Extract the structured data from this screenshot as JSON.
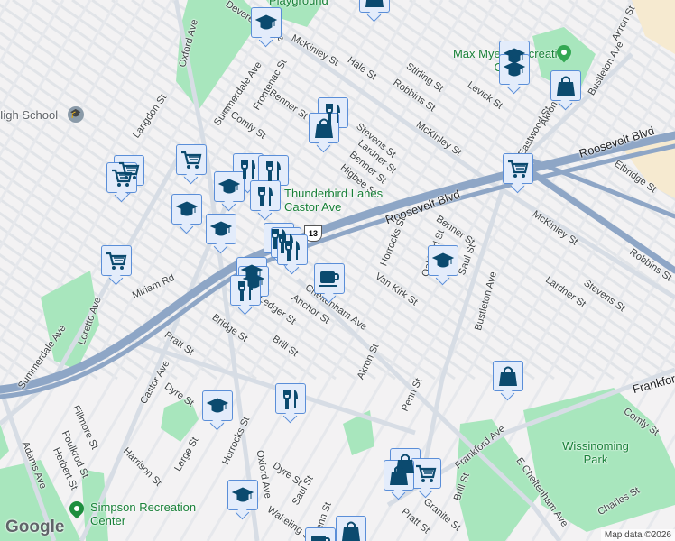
{
  "map": {
    "colors": {
      "background": "#f3f2f3",
      "park": "#a8e6bd",
      "highway": "#8ea6c6",
      "marker_fill": "#e3ecfb",
      "marker_border": "#5a8ed8",
      "icon": "#0b4a6f",
      "poi_text": "#188038"
    },
    "streets": [
      "Devereaux Ave",
      "McKinley St",
      "Oxford Ave",
      "Summerdale Ave",
      "Frontenac St",
      "Benner St",
      "E Comly St",
      "Langdon St",
      "Hale St",
      "Stirling St",
      "Robbins St",
      "Levick St",
      "McKinley St",
      "Stevens St",
      "Lardner St",
      "Benner St",
      "Higbee St",
      "Eastwood St",
      "Akron",
      "Bustleton Ave",
      "Akron St",
      "Roosevelt Blvd",
      "Roosevelt Blvd",
      "Elbridge St",
      "McKinley St",
      "Robbins St",
      "Benner St",
      "Oakland St",
      "Saul St",
      "Horrocks St",
      "Van Kirk St",
      "Miriam Rd",
      "Loretto Ave",
      "Summerdale Ave",
      "Pratt St",
      "Bridge St",
      "Brill St",
      "Anchor St",
      "Cheltenham Ave",
      "Ledger St",
      "Castor Ave",
      "Dyre St",
      "Fillmore St",
      "Foulkrod St",
      "Herbert St",
      "Adams Ave",
      "Harrison St",
      "Large St",
      "Horrocks St",
      "Oxford Ave",
      "Dyre St",
      "Saul St",
      "Wakeling St",
      "Akron St",
      "Penn St",
      "Bustleton Ave",
      "Lardner St",
      "Stevens St",
      "Frankford Ave",
      "Comly St",
      "E Cheltenham Ave",
      "Frankford Ave",
      "Brill St",
      "Granite St",
      "Pratt St",
      "Charles St",
      "Penn St"
    ],
    "route_shield": "13",
    "pois": {
      "high_school": "High School",
      "max_myers": "Max Myers Recreation Center",
      "thunderbird": "Thunderbird Lanes Castor Ave",
      "wissinoming": "Wissinoming Park",
      "simpson": "Simpson Recreation Center",
      "playground": "Playground"
    },
    "markers": [
      {
        "icon": "school-icon"
      },
      {
        "icon": "cart-icon"
      },
      {
        "icon": "cart-icon"
      },
      {
        "icon": "cart-icon"
      },
      {
        "icon": "food-icon"
      },
      {
        "icon": "food-icon"
      },
      {
        "icon": "school-icon"
      },
      {
        "icon": "food-icon"
      },
      {
        "icon": "school-icon"
      },
      {
        "icon": "school-icon"
      },
      {
        "icon": "food-icon"
      },
      {
        "icon": "shopping-bag-icon"
      },
      {
        "icon": "cart-icon"
      },
      {
        "icon": "food-icon"
      },
      {
        "icon": "food-icon"
      },
      {
        "icon": "food-icon"
      },
      {
        "icon": "school-icon"
      },
      {
        "icon": "school-icon"
      },
      {
        "icon": "food-icon"
      },
      {
        "icon": "coffee-icon"
      },
      {
        "icon": "school-icon"
      },
      {
        "icon": "cart-icon"
      },
      {
        "icon": "school-icon"
      },
      {
        "icon": "school-icon"
      },
      {
        "icon": "shopping-bag-icon"
      },
      {
        "icon": "shopping-bag-icon"
      },
      {
        "icon": "school-icon"
      },
      {
        "icon": "food-icon"
      },
      {
        "icon": "school-icon"
      },
      {
        "icon": "shopping-bag-icon"
      },
      {
        "icon": "cart-icon"
      },
      {
        "icon": "shopping-bag-icon"
      },
      {
        "icon": "shopping-bag-icon"
      },
      {
        "icon": "coffee-icon"
      },
      {
        "icon": "shopping-bag-icon"
      }
    ],
    "logo": "Google",
    "attribution": "Map data ©2026"
  }
}
